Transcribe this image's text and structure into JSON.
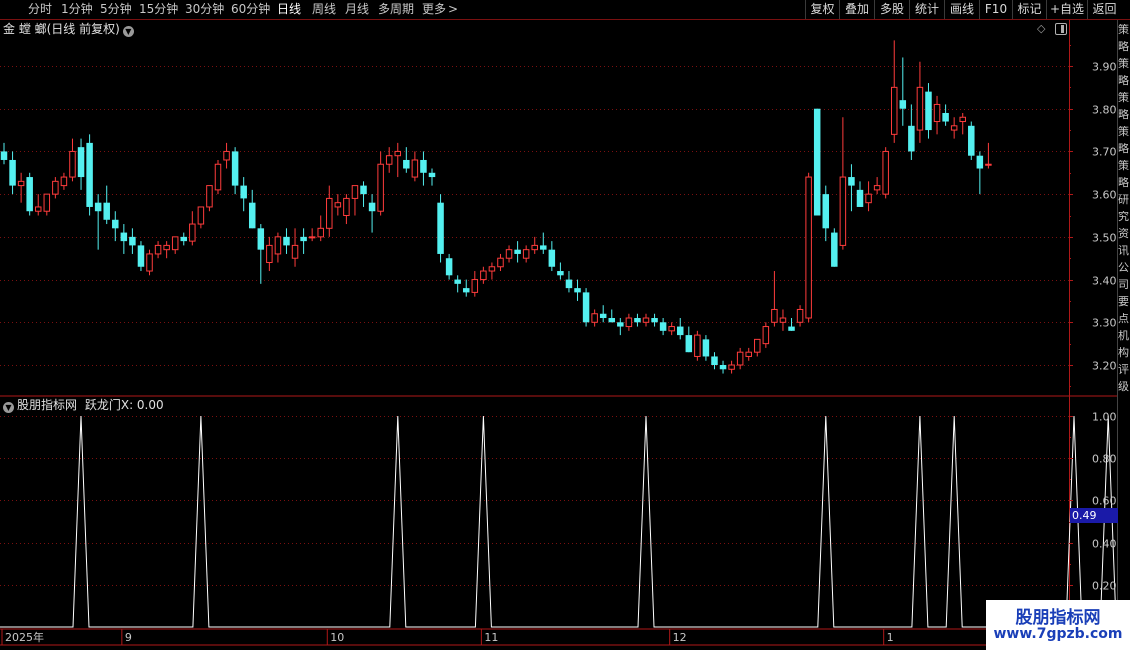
{
  "toolbar": {
    "periods": [
      "分时",
      "1分钟",
      "5分钟",
      "15分钟",
      "30分钟",
      "60分钟",
      "日线",
      "周线",
      "月线",
      "多周期",
      "更多"
    ],
    "active_period": "日线",
    "right_buttons": [
      "复权",
      "叠加",
      "多股",
      "统计",
      "画线",
      "F10",
      "标记",
      "+自选",
      "返回"
    ]
  },
  "main": {
    "title": "金 螳 螂(日线 前复权)"
  },
  "indicator": {
    "title": "股朋指标网",
    "series_label": "跃龙门X: 0.00",
    "cursor_value": "0.49"
  },
  "time_axis": {
    "labels": [
      "2025年",
      "9",
      "10",
      "11",
      "12",
      "1"
    ]
  },
  "right_strip": {
    "chars": "策略策略策略策略策略研究资讯公司要点机构评级"
  },
  "watermark": {
    "line1": "股朋指标网",
    "line2": "www.7gpzb.com"
  },
  "colors": {
    "up": "#ff3c3c",
    "down": "#54f0f0",
    "grid": "#7a1010",
    "axis": "#b01818",
    "label": "#c8c8c8",
    "highlight": "#1a1aa8"
  },
  "chart_data": [
    {
      "type": "candlestick",
      "title": "金 螳 螂(日线 前复权)",
      "ylim": [
        3.15,
        3.98
      ],
      "y_ticks": [
        3.2,
        3.3,
        3.4,
        3.5,
        3.6,
        3.7,
        3.8,
        3.9
      ],
      "grid": true,
      "candles": [
        [
          3.7,
          3.72,
          3.67,
          3.68
        ],
        [
          3.68,
          3.7,
          3.6,
          3.62
        ],
        [
          3.62,
          3.65,
          3.58,
          3.63
        ],
        [
          3.64,
          3.65,
          3.55,
          3.56
        ],
        [
          3.56,
          3.6,
          3.55,
          3.57
        ],
        [
          3.56,
          3.6,
          3.55,
          3.6
        ],
        [
          3.6,
          3.64,
          3.59,
          3.63
        ],
        [
          3.62,
          3.65,
          3.61,
          3.64
        ],
        [
          3.64,
          3.73,
          3.63,
          3.7
        ],
        [
          3.71,
          3.73,
          3.61,
          3.64
        ],
        [
          3.72,
          3.74,
          3.55,
          3.57
        ],
        [
          3.58,
          3.6,
          3.47,
          3.56
        ],
        [
          3.58,
          3.62,
          3.53,
          3.54
        ],
        [
          3.54,
          3.56,
          3.49,
          3.52
        ],
        [
          3.51,
          3.53,
          3.46,
          3.49
        ],
        [
          3.5,
          3.52,
          3.46,
          3.48
        ],
        [
          3.48,
          3.49,
          3.42,
          3.43
        ],
        [
          3.42,
          3.47,
          3.41,
          3.46
        ],
        [
          3.46,
          3.49,
          3.45,
          3.48
        ],
        [
          3.47,
          3.49,
          3.45,
          3.48
        ],
        [
          3.47,
          3.5,
          3.46,
          3.5
        ],
        [
          3.5,
          3.51,
          3.48,
          3.49
        ],
        [
          3.49,
          3.56,
          3.48,
          3.53
        ],
        [
          3.53,
          3.57,
          3.52,
          3.57
        ],
        [
          3.57,
          3.62,
          3.56,
          3.62
        ],
        [
          3.61,
          3.68,
          3.6,
          3.67
        ],
        [
          3.68,
          3.72,
          3.66,
          3.7
        ],
        [
          3.7,
          3.71,
          3.6,
          3.62
        ],
        [
          3.62,
          3.64,
          3.56,
          3.59
        ],
        [
          3.58,
          3.61,
          3.52,
          3.52
        ],
        [
          3.52,
          3.53,
          3.39,
          3.47
        ],
        [
          3.44,
          3.5,
          3.42,
          3.48
        ],
        [
          3.46,
          3.51,
          3.44,
          3.5
        ],
        [
          3.5,
          3.52,
          3.46,
          3.48
        ],
        [
          3.45,
          3.52,
          3.43,
          3.48
        ],
        [
          3.5,
          3.52,
          3.46,
          3.49
        ],
        [
          3.5,
          3.52,
          3.49,
          3.5
        ],
        [
          3.5,
          3.55,
          3.49,
          3.52
        ],
        [
          3.52,
          3.62,
          3.5,
          3.59
        ],
        [
          3.57,
          3.6,
          3.55,
          3.58
        ],
        [
          3.55,
          3.6,
          3.53,
          3.59
        ],
        [
          3.59,
          3.62,
          3.55,
          3.62
        ],
        [
          3.62,
          3.63,
          3.57,
          3.6
        ],
        [
          3.58,
          3.6,
          3.51,
          3.56
        ],
        [
          3.56,
          3.7,
          3.55,
          3.67
        ],
        [
          3.67,
          3.71,
          3.65,
          3.69
        ],
        [
          3.69,
          3.72,
          3.64,
          3.7
        ],
        [
          3.68,
          3.71,
          3.65,
          3.66
        ],
        [
          3.64,
          3.7,
          3.63,
          3.68
        ],
        [
          3.68,
          3.7,
          3.62,
          3.65
        ],
        [
          3.65,
          3.66,
          3.62,
          3.64
        ],
        [
          3.58,
          3.6,
          3.44,
          3.46
        ],
        [
          3.45,
          3.46,
          3.4,
          3.41
        ],
        [
          3.4,
          3.41,
          3.37,
          3.39
        ],
        [
          3.38,
          3.4,
          3.36,
          3.37
        ],
        [
          3.37,
          3.42,
          3.36,
          3.4
        ],
        [
          3.4,
          3.43,
          3.39,
          3.42
        ],
        [
          3.42,
          3.44,
          3.4,
          3.43
        ],
        [
          3.43,
          3.46,
          3.42,
          3.45
        ],
        [
          3.45,
          3.48,
          3.44,
          3.47
        ],
        [
          3.47,
          3.49,
          3.44,
          3.46
        ],
        [
          3.45,
          3.48,
          3.44,
          3.47
        ],
        [
          3.47,
          3.5,
          3.46,
          3.48
        ],
        [
          3.48,
          3.51,
          3.46,
          3.47
        ],
        [
          3.47,
          3.49,
          3.42,
          3.43
        ],
        [
          3.42,
          3.44,
          3.4,
          3.41
        ],
        [
          3.4,
          3.42,
          3.37,
          3.38
        ],
        [
          3.38,
          3.4,
          3.35,
          3.37
        ],
        [
          3.37,
          3.38,
          3.29,
          3.3
        ],
        [
          3.3,
          3.33,
          3.29,
          3.32
        ],
        [
          3.32,
          3.34,
          3.3,
          3.31
        ],
        [
          3.31,
          3.33,
          3.3,
          3.3
        ],
        [
          3.3,
          3.31,
          3.27,
          3.29
        ],
        [
          3.29,
          3.32,
          3.28,
          3.31
        ],
        [
          3.31,
          3.32,
          3.29,
          3.3
        ],
        [
          3.3,
          3.32,
          3.29,
          3.31
        ],
        [
          3.31,
          3.32,
          3.29,
          3.3
        ],
        [
          3.3,
          3.31,
          3.27,
          3.28
        ],
        [
          3.28,
          3.3,
          3.27,
          3.29
        ],
        [
          3.29,
          3.31,
          3.26,
          3.27
        ],
        [
          3.27,
          3.29,
          3.23,
          3.23
        ],
        [
          3.22,
          3.28,
          3.21,
          3.27
        ],
        [
          3.26,
          3.27,
          3.21,
          3.22
        ],
        [
          3.22,
          3.23,
          3.19,
          3.2
        ],
        [
          3.2,
          3.21,
          3.18,
          3.19
        ],
        [
          3.19,
          3.21,
          3.18,
          3.2
        ],
        [
          3.2,
          3.24,
          3.19,
          3.23
        ],
        [
          3.22,
          3.24,
          3.21,
          3.23
        ],
        [
          3.23,
          3.26,
          3.22,
          3.26
        ],
        [
          3.25,
          3.3,
          3.24,
          3.29
        ],
        [
          3.3,
          3.42,
          3.29,
          3.33
        ],
        [
          3.3,
          3.33,
          3.28,
          3.31
        ],
        [
          3.29,
          3.31,
          3.28,
          3.28
        ],
        [
          3.3,
          3.34,
          3.29,
          3.33
        ],
        [
          3.31,
          3.65,
          3.3,
          3.64
        ],
        [
          3.8,
          3.8,
          3.55,
          3.55
        ],
        [
          3.6,
          3.62,
          3.49,
          3.52
        ],
        [
          3.51,
          3.52,
          3.43,
          3.43
        ],
        [
          3.48,
          3.78,
          3.47,
          3.64
        ],
        [
          3.64,
          3.67,
          3.56,
          3.62
        ],
        [
          3.61,
          3.63,
          3.57,
          3.57
        ],
        [
          3.58,
          3.63,
          3.56,
          3.6
        ],
        [
          3.61,
          3.64,
          3.6,
          3.62
        ],
        [
          3.6,
          3.71,
          3.59,
          3.7
        ],
        [
          3.74,
          3.96,
          3.72,
          3.85
        ],
        [
          3.82,
          3.92,
          3.76,
          3.8
        ],
        [
          3.76,
          3.81,
          3.68,
          3.7
        ],
        [
          3.75,
          3.91,
          3.72,
          3.85
        ],
        [
          3.84,
          3.86,
          3.73,
          3.75
        ],
        [
          3.77,
          3.83,
          3.74,
          3.81
        ],
        [
          3.79,
          3.81,
          3.76,
          3.77
        ],
        [
          3.75,
          3.78,
          3.73,
          3.76
        ],
        [
          3.77,
          3.79,
          3.74,
          3.78
        ],
        [
          3.76,
          3.77,
          3.68,
          3.69
        ],
        [
          3.69,
          3.7,
          3.6,
          3.66
        ],
        [
          3.67,
          3.72,
          3.66,
          3.67
        ]
      ]
    },
    {
      "type": "line",
      "title": "股朋指标网",
      "series": [
        {
          "name": "跃龙门X",
          "spike_indices": [
            9,
            23,
            46,
            56,
            75,
            96,
            107,
            111,
            125,
            129
          ]
        }
      ],
      "ylim": [
        0,
        1.05
      ],
      "y_ticks": [
        0.2,
        0.4,
        0.6,
        0.8,
        1.0
      ],
      "cursor_value": 0.49,
      "grid": true
    }
  ]
}
